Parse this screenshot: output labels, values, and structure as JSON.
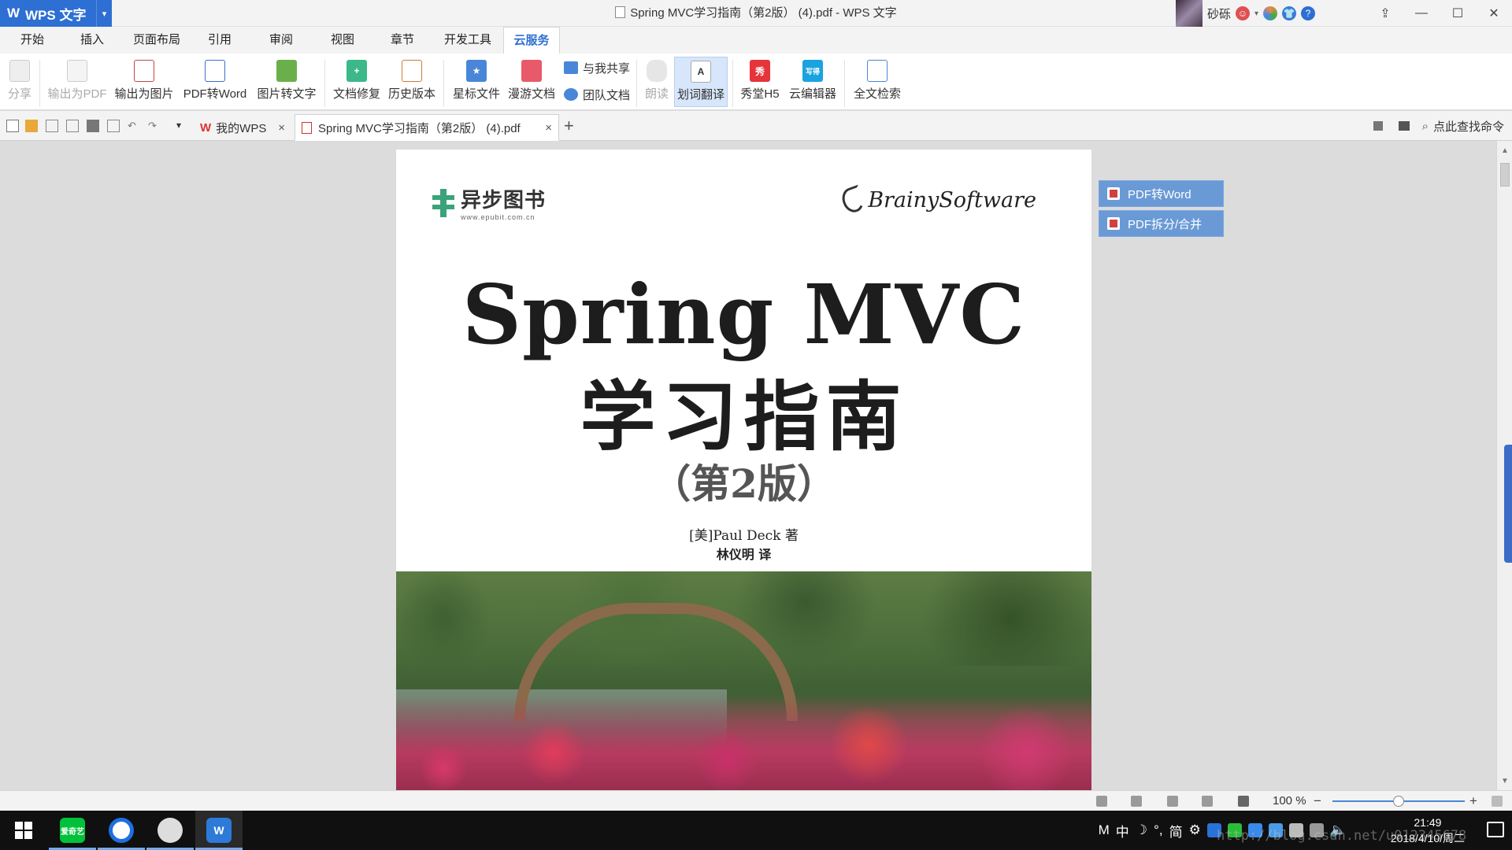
{
  "app": {
    "name": "WPS 文字",
    "window_title": "Spring MVC学习指南（第2版） (4).pdf - WPS 文字",
    "user": "砂砾"
  },
  "menu_tabs": [
    "开始",
    "插入",
    "页面布局",
    "引用",
    "审阅",
    "视图",
    "章节",
    "开发工具",
    "云服务"
  ],
  "active_menu_tab": "云服务",
  "ribbon": {
    "share": "分享",
    "export_pdf": "输出为PDF",
    "export_image": "输出为图片",
    "pdf_to_word": "PDF转Word",
    "image_to_text": "图片转文字",
    "doc_repair": "文档修复",
    "history": "历史版本",
    "starred": "星标文件",
    "roam_docs": "漫游文档",
    "shared_with_me": "与我共享",
    "team_docs": "团队文档",
    "read_aloud": "朗读",
    "translate": "划词翻译",
    "xiutang": "秀堂H5",
    "cloud_editor": "云编辑器",
    "fulltext_search": "全文检索",
    "xiu_icon": "秀",
    "editor_icon": "写得",
    "translate_icon": "A"
  },
  "doc_tabs": [
    {
      "label": "我的WPS",
      "close": "×"
    },
    {
      "label": "Spring MVC学习指南（第2版） (4).pdf",
      "close": "×"
    }
  ],
  "new_tab": "+",
  "search_command": "点此查找命令",
  "page": {
    "publisher_cn": "异步图书",
    "publisher_url": "www.epubit.com.cn",
    "brand": "BrainySoftware",
    "title": "Spring MVC",
    "title_cn": "学习指南",
    "edition": "（第2版）",
    "author": "[美]Paul Deck  著",
    "translator": "林仪明  译"
  },
  "side_panel": {
    "pdf_to_word": "PDF转Word",
    "pdf_split_merge": "PDF拆分/合并"
  },
  "statusbar": {
    "zoom": "100 %",
    "zoom_out": "−",
    "zoom_in": "+",
    "zoom_fraction": 0.5
  },
  "taskbar": {
    "ime_mode": "M",
    "ime_lang": "中",
    "ime_punct": "°,",
    "ime_simplified": "简",
    "time": "21:49",
    "date": "2018/4/10/周二",
    "qiyi_label": "爱奇艺",
    "wps_label": "W"
  },
  "watermark": "http://blog.csdn.net/u012345678"
}
